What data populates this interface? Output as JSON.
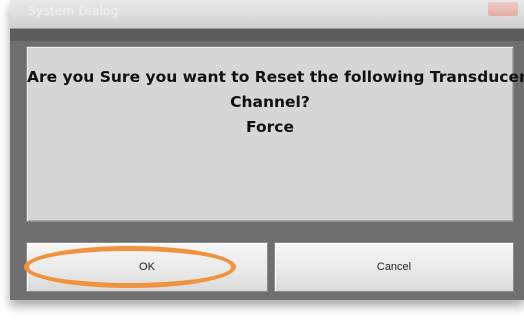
{
  "dialog": {
    "title": "System Dialog",
    "message_lines": [
      "Are you Sure you want to Reset the following Transducer",
      "Channel?",
      "Force"
    ],
    "buttons": {
      "ok_label": "OK",
      "cancel_label": "Cancel"
    }
  },
  "colors": {
    "dialog_frame": "#6f6f6f",
    "panel_background": "#d6d6d6",
    "highlight_ring": "#f0923e"
  },
  "icons": {
    "close": "close-icon"
  }
}
